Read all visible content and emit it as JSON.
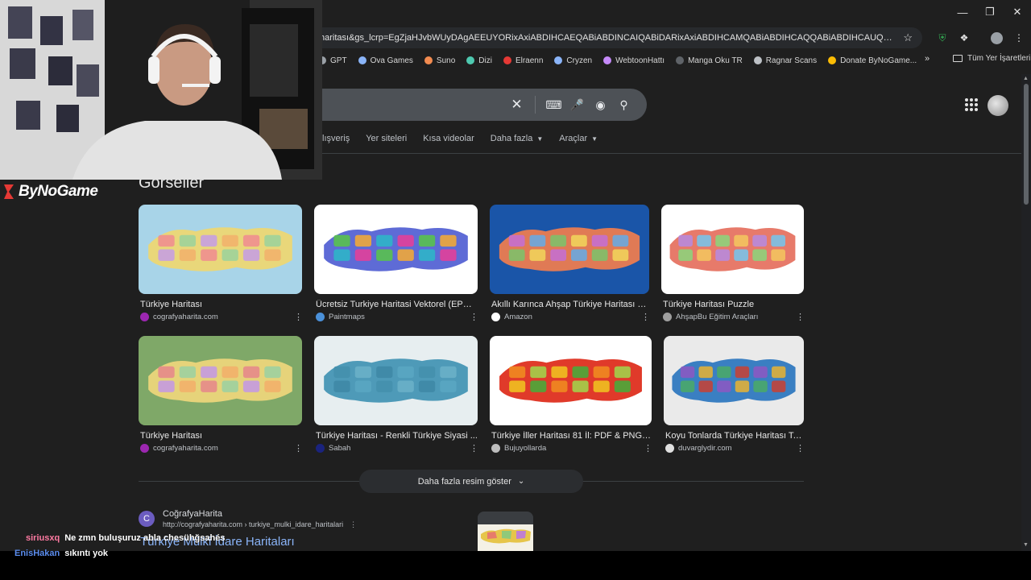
{
  "browser": {
    "url": "haritası&gs_lcrp=EgZjaHJvbWUyDAgAEEUYORixAxiABDIHCAEQABiABDINCAIQABiDARixAxiABDIHCAMQABiABDIHCAQQABiABDIHCAUQABiABDIHCAYQABi...",
    "bookmarks": [
      "GPT",
      "Ova Games",
      "Suno",
      "Dizi",
      "Elraenn",
      "Cryzen",
      "WebtoonHattı",
      "Manga Oku TR",
      "Ragnar Scans",
      "Donate ByNoGame..."
    ],
    "bookmark_colors": [
      "#9aa0a6",
      "#8ab4f8",
      "#f28b50",
      "#4ec9b0",
      "#e53935",
      "#8ab4f8",
      "#c58af9",
      "#5f6368",
      "#bdc1c6",
      "#fbbc04"
    ],
    "bookmarks_more": "»",
    "all_bookmarks": "Tüm Yer İşaretleri"
  },
  "search": {
    "tabs": [
      "lışveriş",
      "Yer siteleri",
      "Kısa videolar",
      "Daha fazla",
      "Araçlar"
    ]
  },
  "images_section": {
    "title": "Görseller",
    "items": [
      {
        "caption": "Türkiye Haritası",
        "source": "cografyaharita.com",
        "fav_color": "#9c27b0"
      },
      {
        "caption": "Ücretsiz Turkiye Haritasi Vektorel (EPS, ...",
        "source": "Paintmaps",
        "fav_color": "#4a90d9"
      },
      {
        "caption": "Akıllı Karınca Ahşap Türkiye Haritası P...",
        "source": "Amazon",
        "fav_color": "#ffffff"
      },
      {
        "caption": "Türkiye Haritası Puzzle",
        "source": "AhşapBu Eğitim Araçları",
        "fav_color": "#9e9e9e"
      },
      {
        "caption": "Türkiye Haritası",
        "source": "cografyaharita.com",
        "fav_color": "#9c27b0"
      },
      {
        "caption": "Türkiye Haritası - Renkli Türkiye Siyasi ...",
        "source": "Sabah",
        "fav_color": "#1a237e"
      },
      {
        "caption": "Türkiye İller Haritası 81 İl: PDF & PNG İ...",
        "source": "Bujuyollarda",
        "fav_color": "#bdbdbd"
      },
      {
        "caption": "Koyu Tonlarda Türkiye Haritası Ta...",
        "source": "duvarglydir.com",
        "fav_color": "#e0e0e0"
      }
    ],
    "more_button": "Daha fazla resim göster"
  },
  "result": {
    "site": "CoğrafyaHarita",
    "url": "http://cografyaharita.com › turkiye_mulki_idare_haritalari",
    "title": "Türkiye Mülki İdare Haritaları",
    "fav_letter": "C"
  },
  "overlay": {
    "logo": "ByNoGame",
    "chat": [
      {
        "user": "siriusxq",
        "user_color": "#ff7aa2",
        "message": "Ne zmn buluşuruz abla chesühğsahés"
      },
      {
        "user": "EnisHakan",
        "user_color": "#5b8def",
        "message": "sıkıntı yok"
      }
    ]
  }
}
